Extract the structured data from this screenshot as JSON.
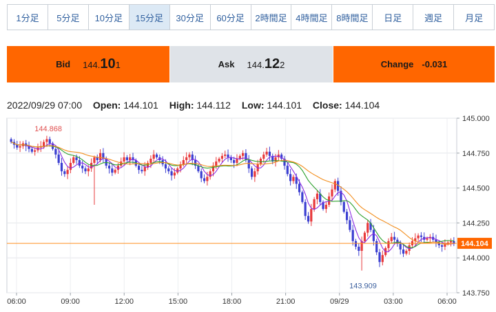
{
  "tabs": [
    {
      "label": "1分足",
      "active": false
    },
    {
      "label": "5分足",
      "active": false
    },
    {
      "label": "10分足",
      "active": false
    },
    {
      "label": "15分足",
      "active": true
    },
    {
      "label": "30分足",
      "active": false
    },
    {
      "label": "60分足",
      "active": false
    },
    {
      "label": "2時間足",
      "active": false
    },
    {
      "label": "4時間足",
      "active": false
    },
    {
      "label": "8時間足",
      "active": false
    },
    {
      "label": "日足",
      "active": false
    },
    {
      "label": "週足",
      "active": false
    },
    {
      "label": "月足",
      "active": false
    }
  ],
  "quote": {
    "bid_label": "Bid",
    "bid_prefix": "144.",
    "bid_big": "10",
    "bid_suffix": "1",
    "ask_label": "Ask",
    "ask_prefix": "144.",
    "ask_big": "12",
    "ask_suffix": "2",
    "change_label": "Change",
    "change_value": "-0.031"
  },
  "ohlc": {
    "datetime": "2022/09/29 07:00",
    "open_label": "Open:",
    "open": "144.101",
    "high_label": "High:",
    "high": "144.112",
    "low_label": "Low:",
    "low": "144.101",
    "close_label": "Close:",
    "close": "144.104"
  },
  "colors": {
    "accent": "#ff6600",
    "up": "#e8393b",
    "down": "#3b3fd1",
    "ma_short": "#8a2be2",
    "ma_mid": "#2ca02c",
    "ma_long": "#f28c1a",
    "price_line": "#ff8c1a"
  },
  "chart_data": {
    "type": "candlestick",
    "ylim": [
      143.75,
      145.0
    ],
    "y_ticks": [
      "145.000",
      "144.750",
      "144.500",
      "144.250",
      "144.000",
      "143.750"
    ],
    "x_ticks": [
      "06:00",
      "09:00",
      "12:00",
      "15:00",
      "18:00",
      "21:00",
      "09/29",
      "03:00",
      "06:00"
    ],
    "current_price": "144.104",
    "high_annotation": "144.868",
    "low_annotation": "143.909",
    "series_close": [
      144.83,
      144.81,
      144.79,
      144.8,
      144.82,
      144.8,
      144.78,
      144.76,
      144.77,
      144.79,
      144.8,
      144.83,
      144.85,
      144.82,
      144.78,
      144.74,
      144.68,
      144.62,
      144.6,
      144.63,
      144.68,
      144.72,
      144.7,
      144.66,
      144.64,
      144.62,
      144.64,
      144.68,
      144.72,
      144.7,
      144.75,
      144.71,
      144.66,
      144.64,
      144.61,
      144.63,
      144.66,
      144.69,
      144.72,
      144.7,
      144.72,
      144.7,
      144.66,
      144.63,
      144.62,
      144.65,
      144.68,
      144.71,
      144.74,
      144.72,
      144.7,
      144.67,
      144.64,
      144.62,
      144.59,
      144.61,
      144.64,
      144.67,
      144.7,
      144.72,
      144.74,
      144.7,
      144.66,
      144.62,
      144.57,
      144.55,
      144.58,
      144.62,
      144.66,
      144.69,
      144.71,
      144.73,
      144.74,
      144.72,
      144.7,
      144.68,
      144.71,
      144.73,
      144.75,
      144.7,
      144.64,
      144.58,
      144.62,
      144.67,
      144.71,
      144.74,
      144.76,
      144.73,
      144.69,
      144.72,
      144.74,
      144.71,
      144.66,
      144.6,
      144.55,
      144.58,
      144.53,
      144.47,
      144.4,
      144.3,
      144.26,
      144.35,
      144.42,
      144.46,
      144.4,
      144.35,
      144.38,
      144.44,
      144.49,
      144.55,
      144.48,
      144.4,
      144.33,
      144.27,
      144.2,
      144.12,
      144.08,
      144.05,
      144.12,
      144.18,
      144.25,
      144.2,
      144.12,
      144.04,
      143.97,
      144.02,
      144.07,
      144.12,
      144.15,
      144.13,
      144.1,
      144.06,
      144.03,
      144.05,
      144.09,
      144.12,
      144.14,
      144.16,
      144.15,
      144.13,
      144.14,
      144.15,
      144.13,
      144.11,
      144.09,
      144.08,
      144.1,
      144.11,
      144.12,
      144.1
    ]
  }
}
